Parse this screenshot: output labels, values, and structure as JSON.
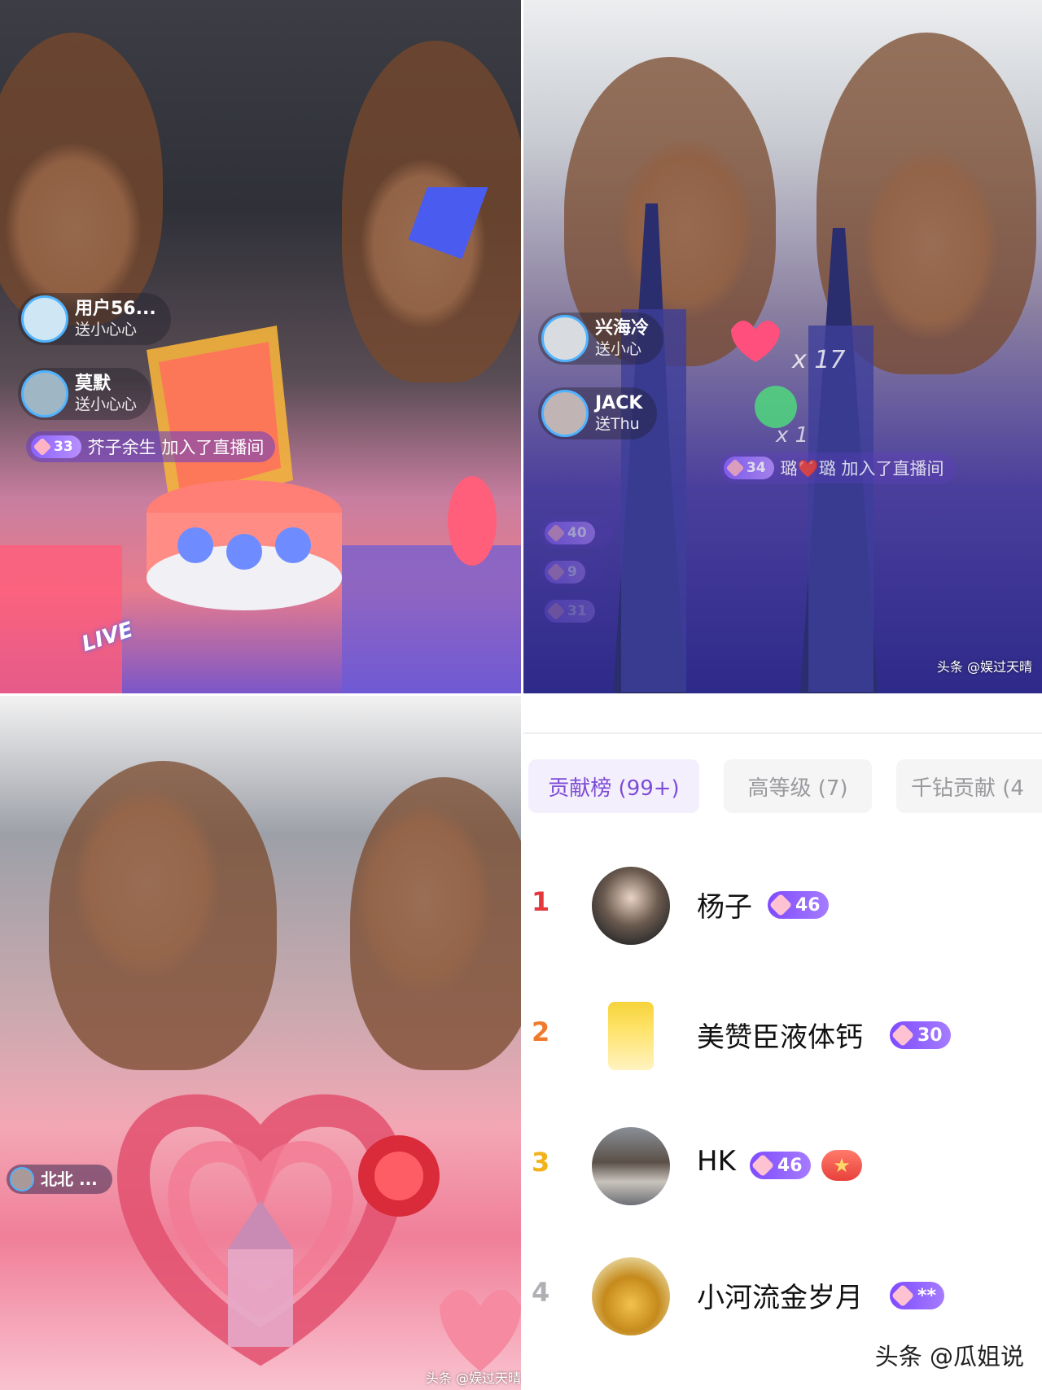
{
  "panel1": {
    "gift_comments": [
      {
        "name": "用户56...",
        "action": "送小心心"
      },
      {
        "name": "莫默",
        "action": "送小心心"
      }
    ],
    "join_notice": {
      "level": "33",
      "text": "芥子余生 加入了直播间"
    },
    "sticker_text": "LIVE"
  },
  "panel2": {
    "gift_comments": [
      {
        "name": "兴海冷",
        "action": "送小心"
      },
      {
        "name": "JACK",
        "action": "送Thu"
      }
    ],
    "join_notice": {
      "level": "34",
      "text": "璐❤️璐 加入了直播间"
    },
    "combo_counts": [
      "x 17",
      "x 1"
    ],
    "faded_levels": [
      "40",
      "9",
      "31"
    ],
    "watermark": "头条 @娱过天晴"
  },
  "panel3": {
    "gift_comments": [
      {
        "name": "北北",
        "action": "..."
      }
    ],
    "watermark": "头条 @娱过天晴"
  },
  "panel4": {
    "tabs": [
      {
        "label": "贡献榜 (99+)",
        "active": true
      },
      {
        "label": "高等级 (7)",
        "active": false
      },
      {
        "label": "千钻贡献 (4",
        "active": false
      }
    ],
    "ranking": [
      {
        "rank": "1",
        "name": "杨子",
        "level": "46",
        "rank_color": "#e4393c"
      },
      {
        "rank": "2",
        "name": "美赞臣液体钙",
        "level": "30",
        "rank_color": "#f07a2c"
      },
      {
        "rank": "3",
        "name": "HK",
        "level": "46",
        "rank_color": "#f2b31a",
        "extra_badge": "★"
      },
      {
        "rank": "4",
        "name": "小河流金岁月",
        "level": "**",
        "rank_color": "#b0b0b4"
      }
    ],
    "footer_watermark": "头条 @瓜姐说"
  }
}
